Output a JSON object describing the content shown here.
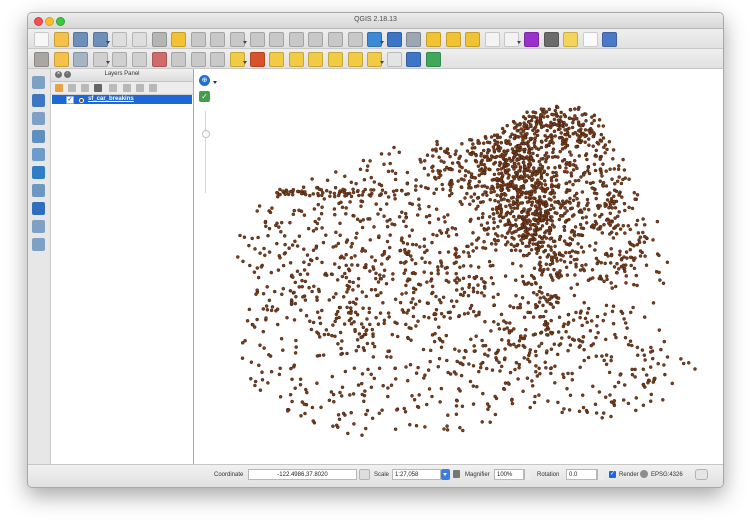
{
  "window": {
    "title": "QGIS 2.18.13"
  },
  "toolbar_top": [
    {
      "icon": "new-project-icon",
      "color": "#f7f7f7"
    },
    {
      "icon": "open-project-icon",
      "color": "#f5c14b"
    },
    {
      "icon": "save-project-icon",
      "color": "#6d8fb9"
    },
    {
      "icon": "save-as-icon",
      "color": "#6d8fb9"
    },
    {
      "icon": "print-composer-icon",
      "color": "#dedede"
    },
    {
      "icon": "composer-manager-icon",
      "color": "#dedede"
    },
    {
      "icon": "pan-icon",
      "color": "#b5b5b5"
    },
    {
      "icon": "pan-to-selection-icon",
      "color": "#f1c232"
    },
    {
      "icon": "zoom-in-icon",
      "color": "#c8c8c8"
    },
    {
      "icon": "zoom-out-icon",
      "color": "#c8c8c8"
    },
    {
      "icon": "zoom-actual-icon",
      "color": "#c8c8c8"
    },
    {
      "icon": "zoom-full-icon",
      "color": "#c8c8c8"
    },
    {
      "icon": "zoom-to-layer-icon",
      "color": "#c8c8c8"
    },
    {
      "icon": "zoom-to-selection-icon",
      "color": "#c8c8c8"
    },
    {
      "icon": "zoom-last-icon",
      "color": "#c8c8c8"
    },
    {
      "icon": "zoom-next-icon",
      "color": "#c8c8c8"
    },
    {
      "icon": "new-map-view-icon",
      "color": "#c8c8c8"
    },
    {
      "icon": "refresh-icon",
      "color": "#3c89d8"
    },
    {
      "icon": "identify-icon",
      "color": "#3a76c5"
    },
    {
      "icon": "actions-icon",
      "color": "#9ca7b2"
    },
    {
      "icon": "select-icon",
      "color": "#f1c232"
    },
    {
      "icon": "select-by-expression-icon",
      "color": "#f1c232"
    },
    {
      "icon": "deselect-icon",
      "color": "#f1c232"
    },
    {
      "icon": "attribute-table-icon",
      "color": "#f3f3f3"
    },
    {
      "icon": "field-calculator-icon",
      "color": "#f3f3f3"
    },
    {
      "icon": "statistics-icon",
      "color": "#9932cc"
    },
    {
      "icon": "measure-icon",
      "color": "#6b6b6b"
    },
    {
      "icon": "map-tips-icon",
      "color": "#f3d55b"
    },
    {
      "icon": "text-annotation-icon",
      "color": "#fafafa"
    },
    {
      "icon": "help-icon",
      "color": "#4b78c7"
    }
  ],
  "toolbar_bottom": [
    {
      "icon": "pencil-icon",
      "color": "#aaa7a3"
    },
    {
      "icon": "edit-icon",
      "color": "#f5c14b"
    },
    {
      "icon": "save-edits-icon",
      "color": "#a6b4c3"
    },
    {
      "icon": "add-feature-icon",
      "color": "#d0d0d0"
    },
    {
      "icon": "move-feature-icon",
      "color": "#d0d0d0"
    },
    {
      "icon": "node-tool-icon",
      "color": "#d0d0d0"
    },
    {
      "icon": "delete-feature-icon",
      "color": "#d06b6b"
    },
    {
      "icon": "cut-feature-icon",
      "color": "#c9c9c9"
    },
    {
      "icon": "copy-feature-icon",
      "color": "#c9c9c9"
    },
    {
      "icon": "paste-feature-icon",
      "color": "#c9c9c9"
    },
    {
      "icon": "labeling-icon",
      "color": "#f2cb45"
    },
    {
      "icon": "style-icon",
      "color": "#d9532a"
    },
    {
      "icon": "label-layer-icon",
      "color": "#f2cb45"
    },
    {
      "icon": "pin-label-icon",
      "color": "#f2cb45"
    },
    {
      "icon": "show-label-icon",
      "color": "#f2cb45"
    },
    {
      "icon": "move-label-icon",
      "color": "#f2cb45"
    },
    {
      "icon": "rotate-label-icon",
      "color": "#f2cb45"
    },
    {
      "icon": "change-label-icon",
      "color": "#f2cb45"
    },
    {
      "icon": "csw-icon",
      "color": "#e4e4e4"
    },
    {
      "icon": "python-console-icon",
      "color": "#3d76c7"
    },
    {
      "icon": "plugin-icon",
      "color": "#41a75a"
    }
  ],
  "left_tools": [
    {
      "icon": "add-vector-layer-icon",
      "color": "#7ea0c4"
    },
    {
      "icon": "add-raster-layer-icon",
      "color": "#3e77bf"
    },
    {
      "icon": "add-postgis-layer-icon",
      "color": "#7ea0c4"
    },
    {
      "icon": "add-spatialite-layer-icon",
      "color": "#5e8fbe"
    },
    {
      "icon": "add-wms-layer-icon",
      "color": "#6b9cca"
    },
    {
      "icon": "add-wcs-layer-icon",
      "color": "#2f7cc7"
    },
    {
      "icon": "add-wfs-layer-icon",
      "color": "#6f97c3"
    },
    {
      "icon": "add-delimited-text-layer-icon",
      "color": "#2f6fbf"
    },
    {
      "icon": "add-virtual-layer-icon",
      "color": "#7ea0c4"
    },
    {
      "icon": "new-shapefile-layer-icon",
      "color": "#7ea0c4"
    }
  ],
  "layers_panel": {
    "title": "Layers Panel",
    "layer_name": "sf_car_breakins",
    "layer_checked": "✓"
  },
  "map": {
    "compass_symbol": "⊕",
    "check_symbol": "✓",
    "point_color": "#7b3e1a"
  },
  "status": {
    "coordinate_label": "Coordinate",
    "coordinate_value": "-122.4986,37.8020",
    "scale_label": "Scale",
    "scale_value": "1:27,058",
    "magnifier_label": "Magnifier",
    "magnifier_value": "100%",
    "rotation_label": "Rotation",
    "rotation_value": "0.0",
    "render_label": "Render",
    "render_checked": "✓",
    "epsg_label": "EPSG:4326"
  }
}
